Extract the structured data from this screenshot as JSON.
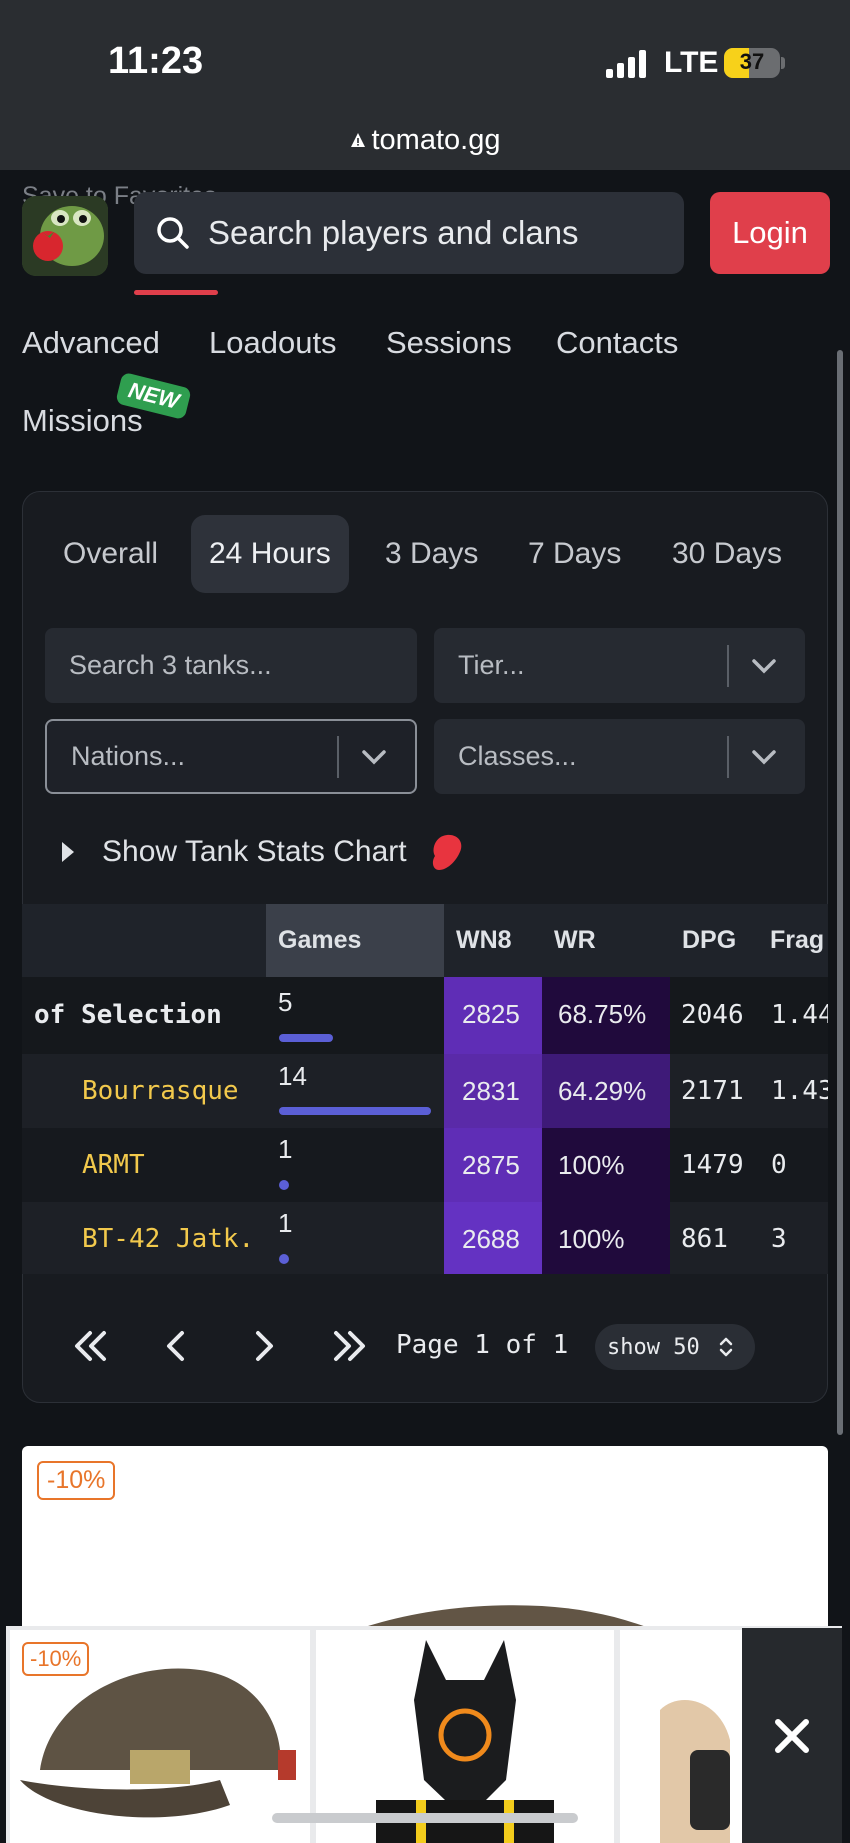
{
  "status_bar": {
    "time": "11:23",
    "network": "LTE",
    "battery": "37"
  },
  "browser": {
    "url": "tomato.gg"
  },
  "header": {
    "peek_text": "Save to Favorites",
    "search_placeholder": "Search players and clans",
    "login_label": "Login"
  },
  "nav": {
    "row1": [
      "Advanced",
      "Loadouts",
      "Sessions",
      "Contacts"
    ],
    "missions": "Missions",
    "new_badge": "NEW"
  },
  "periods": [
    "Overall",
    "24 Hours",
    "3 Days",
    "7 Days",
    "30 Days"
  ],
  "active_period": "24 Hours",
  "filters": {
    "search_placeholder": "Search 3 tanks...",
    "tier": "Tier...",
    "nations": "Nations...",
    "classes": "Classes..."
  },
  "chart_toggle": {
    "label": "Show Tank Stats Chart"
  },
  "table": {
    "columns": [
      "Games",
      "WN8",
      "WR",
      "DPG",
      "Frag"
    ],
    "rows": [
      {
        "name": "of Selection",
        "games": "5",
        "games_value": 5,
        "wn8": "2825",
        "wr": "68.75%",
        "dpg": "2046",
        "frags": "1.44"
      },
      {
        "name": "Bourrasque",
        "games": "14",
        "games_value": 14,
        "wn8": "2831",
        "wr": "64.29%",
        "dpg": "2171",
        "frags": "1.43"
      },
      {
        "name": "ARMT",
        "games": "1",
        "games_value": 1,
        "wn8": "2875",
        "wr": "100%",
        "dpg": "1479",
        "frags": "0"
      },
      {
        "name": "BT-42 Jatk.",
        "games": "1",
        "games_value": 1,
        "wn8": "2688",
        "wr": "100%",
        "dpg": "861",
        "frags": "3"
      }
    ]
  },
  "pagination": {
    "page": "Page",
    "current": "1",
    "of": "of",
    "total": "1",
    "show_label": "show",
    "show_value": "50"
  },
  "ad": {
    "discount_main": "-10%",
    "discount_thumb": "-10%"
  },
  "colors": {
    "accent_red": "#e03f4b",
    "tank_name": "#f2c94c",
    "bar": "#5b5fd6",
    "wn8_purple": "#5f2db6",
    "wr_dark": "#200a3c",
    "new_green": "#2f9e4f"
  }
}
